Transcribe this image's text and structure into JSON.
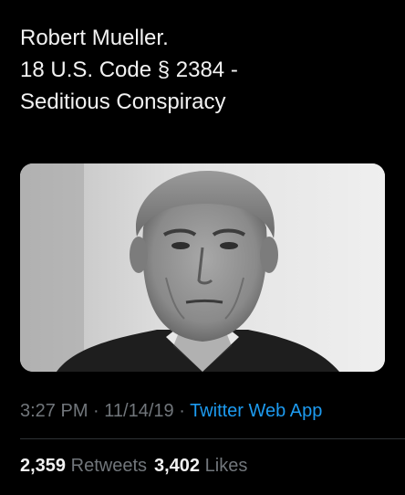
{
  "tweet": {
    "text": "Robert Mueller.\n18 U.S. Code § 2384 -\nSeditious Conspiracy",
    "time": "3:27 PM",
    "separator": " · ",
    "date": "11/14/19",
    "source": "Twitter Web App"
  },
  "stats": {
    "retweets_count": "2,359",
    "retweets_label": "Retweets",
    "likes_count": "3,402",
    "likes_label": "Likes"
  },
  "colors": {
    "background": "#000000",
    "text": "#f2f2f2",
    "muted": "#71767b",
    "link": "#1d9bf0"
  }
}
